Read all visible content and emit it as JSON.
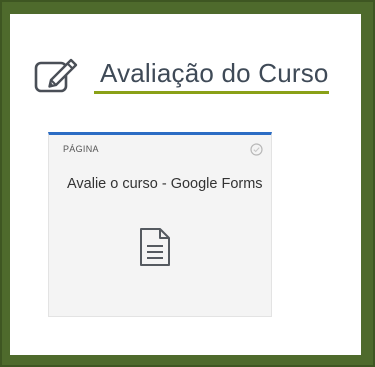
{
  "section": {
    "title": "Avaliação do Curso",
    "icon": "edit-icon",
    "accent_color": "#8aa117"
  },
  "card": {
    "type_label": "PÁGINA",
    "title": "Avalie o curso - Google Forms",
    "icon": "document-icon",
    "status_icon": "completion-circle-icon",
    "top_border_color": "#2b6cc4"
  },
  "frame": {
    "border_color": "#4e6a2c"
  }
}
